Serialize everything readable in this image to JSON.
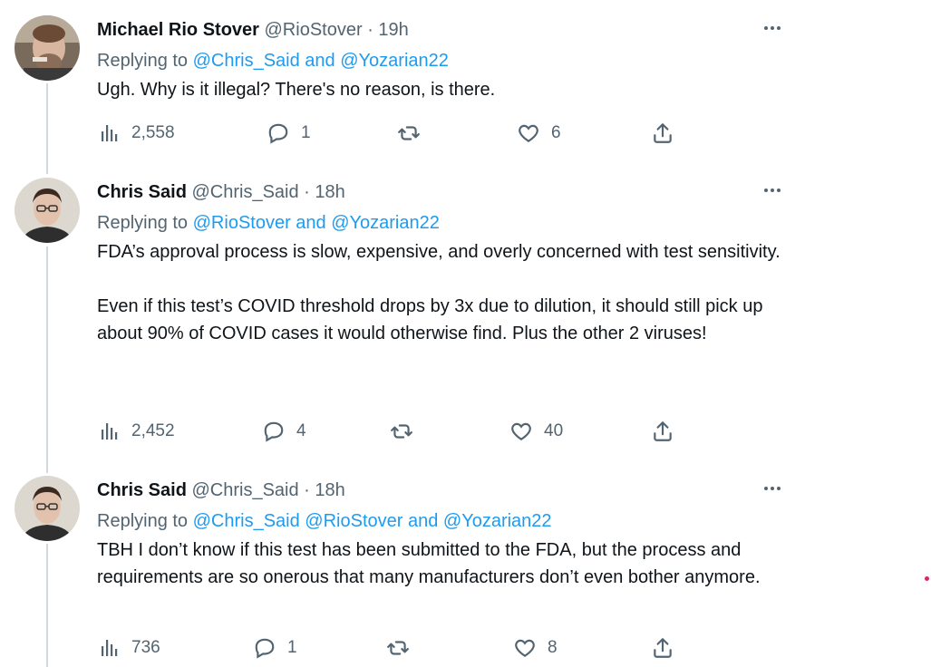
{
  "tweets": [
    {
      "name": "Michael Rio Stover",
      "handle": "@RioStover",
      "time": "· 19h",
      "replying_prefix": "Replying to",
      "replying_links": "@Chris_Said and @Yozarian22",
      "body": "Ugh. Why is it illegal? There's no reason, is there.",
      "views": "2,558",
      "replies": "1",
      "retweets": "",
      "likes": "6"
    },
    {
      "name": "Chris Said",
      "handle": "@Chris_Said",
      "time": "· 18h",
      "replying_prefix": "Replying to",
      "replying_links": "@RioStover and @Yozarian22",
      "body": "FDA’s approval process is slow, expensive, and overly concerned with test sensitivity.\n\nEven if this test’s COVID threshold drops by 3x due to dilution, it should still pick up about 90% of COVID cases it would otherwise find. Plus the other 2 viruses!",
      "views": "2,452",
      "replies": "4",
      "retweets": "",
      "likes": "40"
    },
    {
      "name": "Chris Said",
      "handle": "@Chris_Said",
      "time": "· 18h",
      "replying_prefix": "Replying to",
      "replying_links": "@Chris_Said @RioStover and @Yozarian22",
      "body": "TBH I don’t know if this test has been submitted to the FDA, but the process and requirements are so onerous that many manufacturers don’t even bother anymore.",
      "views": "736",
      "replies": "1",
      "retweets": "",
      "likes": "8"
    }
  ],
  "icons": {
    "views": "views-icon",
    "reply": "reply-icon",
    "retweet": "retweet-icon",
    "like": "heart-icon",
    "share": "share-icon",
    "more": "more-icon"
  },
  "colors": {
    "link": "#1d9bf0",
    "muted": "#536471",
    "thread_line": "#cfd9de"
  }
}
